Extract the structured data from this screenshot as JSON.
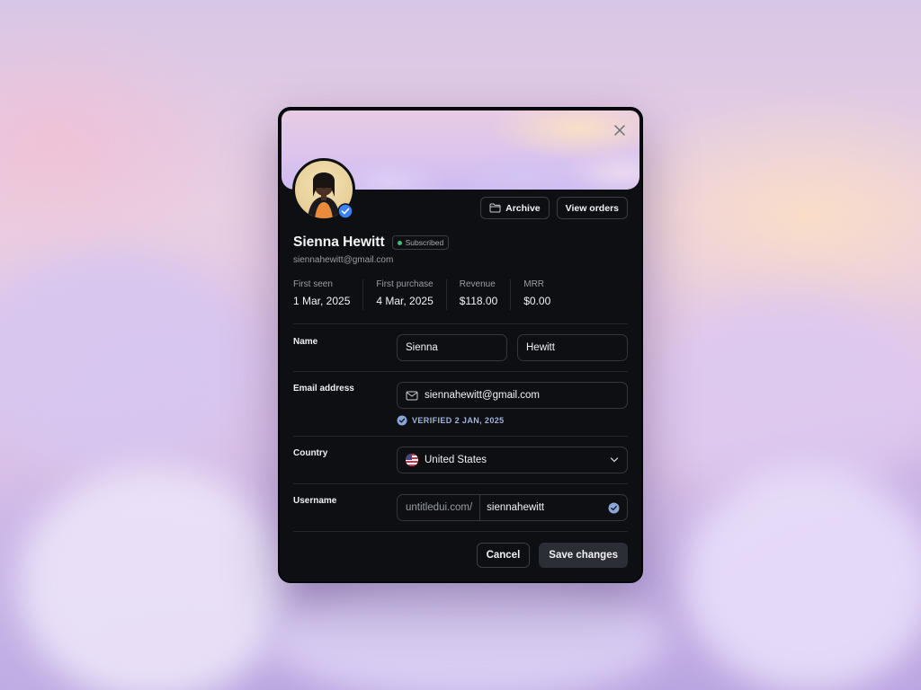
{
  "colors": {
    "accent": "#3b82f6",
    "status_green": "#3fbf7f",
    "verified_text": "#9fb3dc"
  },
  "modal": {
    "close_icon": "x-icon",
    "actions": {
      "archive": "Archive",
      "view_orders": "View orders"
    },
    "profile": {
      "name": "Sienna Hewitt",
      "badge": "Subscribed",
      "email": "siennahewitt@gmail.com"
    },
    "stats": [
      {
        "label": "First seen",
        "value": "1 Mar, 2025"
      },
      {
        "label": "First purchase",
        "value": "4 Mar, 2025"
      },
      {
        "label": "Revenue",
        "value": "$118.00"
      },
      {
        "label": "MRR",
        "value": "$0.00"
      }
    ],
    "form": {
      "name_label": "Name",
      "first_name": "Sienna",
      "last_name": "Hewitt",
      "email_label": "Email address",
      "email": "siennahewitt@gmail.com",
      "verified_note": "VERIFIED 2 JAN, 2025",
      "country_label": "Country",
      "country": "United States",
      "username_label": "Username",
      "username_prefix": "untitledui.com/",
      "username": "siennahewitt"
    },
    "footer": {
      "cancel": "Cancel",
      "save": "Save changes"
    }
  }
}
